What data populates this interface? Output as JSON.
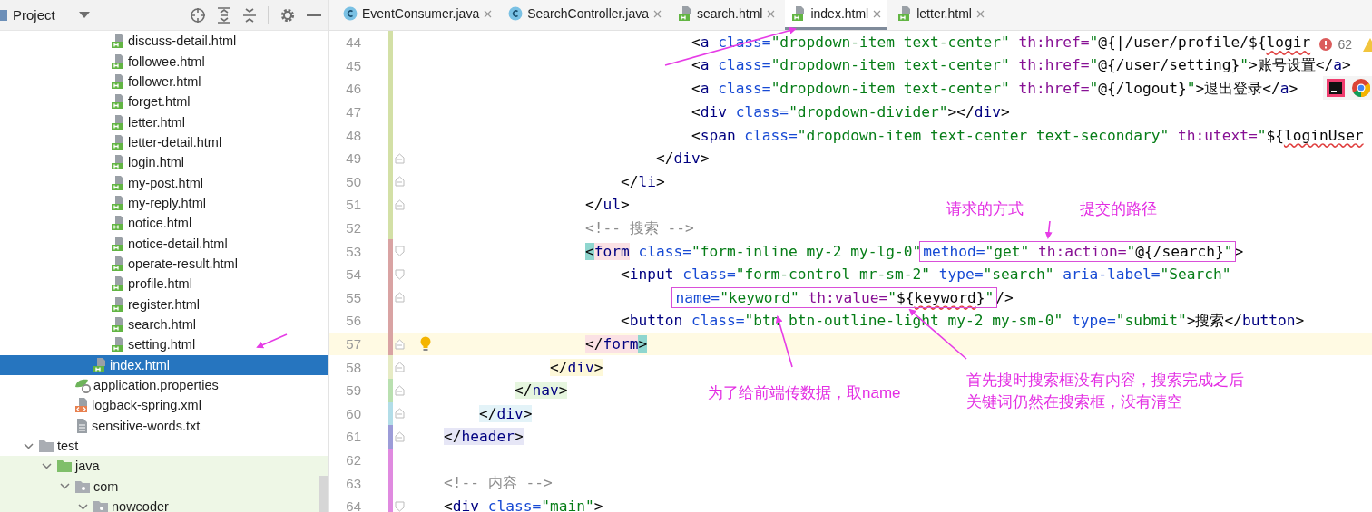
{
  "project_panel": {
    "title": "Project"
  },
  "tree": [
    {
      "children": [
        {
          "children": [
            {
              "children": [
                {
                  "children": [
                    {
                      "label": "discuss-detail.html",
                      "kind": "html",
                      "selected": false
                    },
                    {
                      "label": "followee.html",
                      "kind": "html",
                      "selected": false
                    },
                    {
                      "label": "follower.html",
                      "kind": "html",
                      "selected": false
                    },
                    {
                      "label": "forget.html",
                      "kind": "html",
                      "selected": false
                    },
                    {
                      "label": "letter.html",
                      "kind": "html",
                      "selected": false
                    },
                    {
                      "label": "letter-detail.html",
                      "kind": "html",
                      "selected": false
                    },
                    {
                      "label": "login.html",
                      "kind": "html",
                      "selected": false
                    },
                    {
                      "label": "my-post.html",
                      "kind": "html",
                      "selected": false
                    },
                    {
                      "label": "my-reply.html",
                      "kind": "html",
                      "selected": false
                    },
                    {
                      "label": "notice.html",
                      "kind": "html",
                      "selected": false
                    },
                    {
                      "label": "notice-detail.html",
                      "kind": "html",
                      "selected": false
                    },
                    {
                      "label": "operate-result.html",
                      "kind": "html",
                      "selected": false
                    },
                    {
                      "label": "profile.html",
                      "kind": "html",
                      "selected": false
                    },
                    {
                      "label": "register.html",
                      "kind": "html",
                      "selected": false
                    },
                    {
                      "label": "search.html",
                      "kind": "html",
                      "selected": false
                    },
                    {
                      "label": "setting.html",
                      "kind": "html",
                      "selected": false
                    }
                  ]
                },
                {
                  "label": "index.html",
                  "kind": "html",
                  "selected": true
                }
              ]
            },
            {
              "label": "application.properties",
              "kind": "properties",
              "selected": false
            },
            {
              "label": "logback-spring.xml",
              "kind": "xml",
              "selected": false
            },
            {
              "label": "sensitive-words.txt",
              "kind": "text",
              "selected": false
            }
          ]
        }
      ]
    },
    {
      "label": "test",
      "kind": "folder",
      "expanded": true,
      "selected": false,
      "children": [
        {
          "label": "java",
          "kind": "test-source-folder",
          "expanded": true,
          "selected": false,
          "children": [
            {
              "label": "com",
              "kind": "test-package",
              "expanded": true,
              "selected": false,
              "children": [
                {
                  "label": "nowcoder",
                  "kind": "test-package",
                  "expanded": true,
                  "selected": false
                }
              ]
            }
          ]
        }
      ]
    }
  ],
  "tabs": [
    {
      "label": "EventConsumer.java",
      "kind": "java",
      "selected": false
    },
    {
      "label": "SearchController.java",
      "kind": "java",
      "selected": false
    },
    {
      "label": "search.html",
      "kind": "html",
      "selected": false
    },
    {
      "label": "index.html",
      "kind": "html",
      "selected": true
    },
    {
      "label": "letter.html",
      "kind": "html",
      "selected": false
    }
  ],
  "problems": {
    "errors": "62"
  },
  "lines": [
    {
      "no": "44",
      "color": "#d3e0a6",
      "fold_start": false,
      "fold_end": false,
      "current": false,
      "bulb": false,
      "parts": [
        {
          "boxed": false,
          "tokens": [
            {
              "kind": "p",
              "text": "                            <"
            },
            {
              "kind": "tag",
              "text": "a"
            },
            {
              "kind": "attr",
              "text": " class="
            },
            {
              "kind": "str",
              "text": "\"dropdown-item text-center\""
            },
            {
              "kind": "th",
              "text": " th:href="
            },
            {
              "kind": "str",
              "text": "\""
            },
            {
              "kind": "expr",
              "text": "@{|/user/profile/${"
            },
            {
              "kind": "err",
              "text": "logir"
            }
          ]
        }
      ]
    },
    {
      "no": "45",
      "color": "#d3e0a6",
      "fold_start": false,
      "fold_end": false,
      "current": false,
      "bulb": false,
      "parts": [
        {
          "boxed": false,
          "tokens": [
            {
              "kind": "p",
              "text": "                            <"
            },
            {
              "kind": "tag",
              "text": "a"
            },
            {
              "kind": "attr",
              "text": " class="
            },
            {
              "kind": "str",
              "text": "\"dropdown-item text-center\""
            },
            {
              "kind": "th",
              "text": " th:href="
            },
            {
              "kind": "str",
              "text": "\""
            },
            {
              "kind": "expr",
              "text": "@{/user/setting}"
            },
            {
              "kind": "str",
              "text": "\""
            },
            {
              "kind": "p",
              "text": ">"
            },
            {
              "kind": "text",
              "text": "账号设置"
            },
            {
              "kind": "p",
              "text": "</"
            },
            {
              "kind": "tag",
              "text": "a"
            },
            {
              "kind": "p",
              "text": ">"
            }
          ]
        }
      ]
    },
    {
      "no": "46",
      "color": "#d3e0a6",
      "fold_start": false,
      "fold_end": false,
      "current": false,
      "bulb": false,
      "parts": [
        {
          "boxed": false,
          "tokens": [
            {
              "kind": "p",
              "text": "                            <"
            },
            {
              "kind": "tag",
              "text": "a"
            },
            {
              "kind": "attr",
              "text": " class="
            },
            {
              "kind": "str",
              "text": "\"dropdown-item text-center\""
            },
            {
              "kind": "th",
              "text": " th:href="
            },
            {
              "kind": "str",
              "text": "\""
            },
            {
              "kind": "expr",
              "text": "@{/logout}"
            },
            {
              "kind": "str",
              "text": "\""
            },
            {
              "kind": "p",
              "text": ">"
            },
            {
              "kind": "text",
              "text": "退出登录"
            },
            {
              "kind": "p",
              "text": "</"
            },
            {
              "kind": "tag",
              "text": "a"
            },
            {
              "kind": "p",
              "text": ">"
            }
          ]
        }
      ]
    },
    {
      "no": "47",
      "color": "#d3e0a6",
      "fold_start": false,
      "fold_end": false,
      "current": false,
      "bulb": false,
      "parts": [
        {
          "boxed": false,
          "tokens": [
            {
              "kind": "p",
              "text": "                            <"
            },
            {
              "kind": "tag",
              "text": "div"
            },
            {
              "kind": "attr",
              "text": " class="
            },
            {
              "kind": "str",
              "text": "\"dropdown-divider\""
            },
            {
              "kind": "p",
              "text": "></"
            },
            {
              "kind": "tag",
              "text": "div"
            },
            {
              "kind": "p",
              "text": ">"
            }
          ]
        }
      ]
    },
    {
      "no": "48",
      "color": "#d3e0a6",
      "fold_start": false,
      "fold_end": false,
      "current": false,
      "bulb": false,
      "parts": [
        {
          "boxed": false,
          "tokens": [
            {
              "kind": "p",
              "text": "                            <"
            },
            {
              "kind": "tag",
              "text": "span"
            },
            {
              "kind": "attr",
              "text": " class="
            },
            {
              "kind": "str",
              "text": "\"dropdown-item text-center text-secondary\""
            },
            {
              "kind": "th",
              "text": " th:utext="
            },
            {
              "kind": "str",
              "text": "\""
            },
            {
              "kind": "expr",
              "text": "${"
            },
            {
              "kind": "err",
              "text": "loginUser"
            }
          ]
        }
      ]
    },
    {
      "no": "49",
      "color": "#d3e0a6",
      "fold_start": false,
      "fold_end": true,
      "current": false,
      "bulb": false,
      "parts": [
        {
          "boxed": false,
          "tokens": [
            {
              "kind": "p",
              "text": "                        </"
            },
            {
              "kind": "tag",
              "text": "div"
            },
            {
              "kind": "p",
              "text": ">"
            }
          ]
        }
      ]
    },
    {
      "no": "50",
      "color": "#d3e0a6",
      "fold_start": false,
      "fold_end": true,
      "current": false,
      "bulb": false,
      "parts": [
        {
          "boxed": false,
          "tokens": [
            {
              "kind": "p",
              "text": "                    </"
            },
            {
              "kind": "tag",
              "text": "li"
            },
            {
              "kind": "p",
              "text": ">"
            }
          ]
        }
      ]
    },
    {
      "no": "51",
      "color": "#d3e0a6",
      "fold_start": false,
      "fold_end": true,
      "current": false,
      "bulb": false,
      "parts": [
        {
          "boxed": false,
          "tokens": [
            {
              "kind": "p",
              "text": "                </"
            },
            {
              "kind": "tag",
              "text": "ul"
            },
            {
              "kind": "p",
              "text": ">"
            }
          ]
        }
      ]
    },
    {
      "no": "52",
      "color": "#d3e0a6",
      "fold_start": false,
      "fold_end": false,
      "current": false,
      "bulb": false,
      "parts": [
        {
          "boxed": false,
          "tokens": [
            {
              "kind": "comment",
              "text": "                <!-- 搜索 -->"
            }
          ]
        }
      ]
    },
    {
      "no": "53",
      "color": "#d9a3a3",
      "fold_start": true,
      "fold_end": false,
      "current": false,
      "bulb": false,
      "parts": [
        {
          "boxed": false,
          "tokens": [
            {
              "kind": "p",
              "text": "                <",
              "color": "#8fd6cf"
            },
            {
              "kind": "tag",
              "text": "form",
              "color": "#fbe1e4"
            },
            {
              "kind": "attr",
              "text": " class="
            },
            {
              "kind": "str",
              "text": "\"form-inline my-2 my-lg-0\""
            }
          ]
        },
        {
          "boxed": true,
          "tokens": [
            {
              "kind": "attr",
              "text": "method="
            },
            {
              "kind": "str",
              "text": "\"get\""
            },
            {
              "kind": "th",
              "text": " th:action="
            },
            {
              "kind": "str",
              "text": "\""
            },
            {
              "kind": "expr",
              "text": "@{/search}"
            },
            {
              "kind": "str",
              "text": "\""
            }
          ]
        },
        {
          "boxed": false,
          "tokens": [
            {
              "kind": "p",
              "text": ">"
            }
          ]
        }
      ]
    },
    {
      "no": "54",
      "color": "#d9a3a3",
      "fold_start": true,
      "fold_end": false,
      "current": false,
      "bulb": false,
      "parts": [
        {
          "boxed": false,
          "tokens": [
            {
              "kind": "p",
              "text": "                    <"
            },
            {
              "kind": "tag",
              "text": "input"
            },
            {
              "kind": "attr",
              "text": " class="
            },
            {
              "kind": "str",
              "text": "\"form-control mr-sm-2\""
            },
            {
              "kind": "attr",
              "text": " type="
            },
            {
              "kind": "str",
              "text": "\"search\""
            },
            {
              "kind": "attr",
              "text": " aria-label="
            },
            {
              "kind": "str",
              "text": "\"Search\""
            }
          ]
        }
      ]
    },
    {
      "no": "55",
      "color": "#d9a3a3",
      "fold_start": false,
      "fold_end": true,
      "current": false,
      "bulb": false,
      "parts": [
        {
          "boxed": true,
          "tokens": [
            {
              "kind": "attr",
              "text": "                          name="
            },
            {
              "kind": "str",
              "text": "\"keyword\""
            },
            {
              "kind": "th",
              "text": " th:value="
            },
            {
              "kind": "str",
              "text": "\""
            },
            {
              "kind": "expr",
              "text": "${"
            },
            {
              "kind": "err",
              "text": "keyword"
            },
            {
              "kind": "expr",
              "text": "}"
            },
            {
              "kind": "str",
              "text": "\""
            }
          ]
        },
        {
          "boxed": false,
          "tokens": [
            {
              "kind": "p",
              "text": "/>"
            }
          ]
        }
      ]
    },
    {
      "no": "56",
      "color": "#d9a3a3",
      "fold_start": false,
      "fold_end": false,
      "current": false,
      "bulb": false,
      "parts": [
        {
          "boxed": false,
          "tokens": [
            {
              "kind": "p",
              "text": "                    <"
            },
            {
              "kind": "tag",
              "text": "button"
            },
            {
              "kind": "attr",
              "text": " class="
            },
            {
              "kind": "str",
              "text": "\"btn btn-outline-light my-2 my-sm-0\""
            },
            {
              "kind": "attr",
              "text": " type="
            },
            {
              "kind": "str",
              "text": "\"submit\""
            },
            {
              "kind": "p",
              "text": ">"
            },
            {
              "kind": "text",
              "text": "搜索"
            },
            {
              "kind": "p",
              "text": "</"
            },
            {
              "kind": "tag",
              "text": "button"
            },
            {
              "kind": "p",
              "text": ">"
            }
          ]
        }
      ]
    },
    {
      "no": "57",
      "color": "#d9a3a3",
      "fold_start": false,
      "fold_end": true,
      "current": true,
      "bulb": true,
      "parts": [
        {
          "boxed": false,
          "tokens": [
            {
              "kind": "p",
              "text": "                </",
              "color": "#fbe1e4"
            },
            {
              "kind": "tag",
              "text": "form",
              "color": "#fbe1e4"
            },
            {
              "kind": "p",
              "text": ">",
              "color": "#8fd6cf"
            }
          ]
        }
      ]
    },
    {
      "no": "58",
      "color": "#e6ebc4",
      "fold_start": false,
      "fold_end": true,
      "current": false,
      "bulb": false,
      "parts": [
        {
          "boxed": false,
          "tokens": [
            {
              "kind": "p",
              "text": "            </",
              "color": "#fdf8d8"
            },
            {
              "kind": "tag",
              "text": "div",
              "color": "#fdf8d8"
            },
            {
              "kind": "p",
              "text": ">",
              "color": "#fdf8d8"
            }
          ]
        }
      ]
    },
    {
      "no": "59",
      "color": "#b9e0b0",
      "fold_start": false,
      "fold_end": true,
      "current": false,
      "bulb": false,
      "parts": [
        {
          "boxed": false,
          "tokens": [
            {
              "kind": "p",
              "text": "        </",
              "color": "#e6f6df"
            },
            {
              "kind": "tag",
              "text": "nav",
              "color": "#e6f6df"
            },
            {
              "kind": "p",
              "text": ">",
              "color": "#e6f6df"
            }
          ]
        }
      ]
    },
    {
      "no": "60",
      "color": "#b2dde8",
      "fold_start": false,
      "fold_end": true,
      "current": false,
      "bulb": false,
      "parts": [
        {
          "boxed": false,
          "tokens": [
            {
              "kind": "p",
              "text": "    </",
              "color": "#e3f3f8"
            },
            {
              "kind": "tag",
              "text": "div",
              "color": "#e3f3f8"
            },
            {
              "kind": "p",
              "text": ">",
              "color": "#e3f3f8"
            }
          ]
        }
      ]
    },
    {
      "no": "61",
      "color": "#9c9cd8",
      "fold_start": false,
      "fold_end": true,
      "current": false,
      "bulb": false,
      "parts": [
        {
          "boxed": false,
          "tokens": [
            {
              "kind": "p",
              "text": "</",
              "color": "#e6e6f6"
            },
            {
              "kind": "tag",
              "text": "header",
              "color": "#e6e6f6"
            },
            {
              "kind": "p",
              "text": ">",
              "color": "#e6e6f6"
            }
          ]
        }
      ]
    },
    {
      "no": "62",
      "color": "#e08ae0",
      "fold_start": false,
      "fold_end": false,
      "current": false,
      "bulb": false
    },
    {
      "no": "63",
      "color": "#e08ae0",
      "fold_start": false,
      "fold_end": false,
      "current": false,
      "bulb": false,
      "parts": [
        {
          "boxed": false,
          "tokens": [
            {
              "kind": "comment",
              "text": "<!-- 内容 -->"
            }
          ]
        }
      ]
    },
    {
      "no": "64",
      "color": "#e08ae0",
      "fold_start": true,
      "fold_end": false,
      "current": false,
      "bulb": false,
      "parts": [
        {
          "boxed": false,
          "tokens": [
            {
              "kind": "p",
              "text": "<"
            },
            {
              "kind": "tag",
              "text": "div"
            },
            {
              "kind": "attr",
              "text": " class="
            },
            {
              "kind": "str",
              "text": "\"main\""
            },
            {
              "kind": "p",
              "text": ">"
            }
          ]
        }
      ]
    }
  ],
  "annotations": [
    {
      "text": "请求的方式"
    },
    {
      "text": "提交的路径"
    },
    {
      "text": "为了给前端传数据，取name"
    },
    {
      "text": "首先搜时搜索框没有内容，搜索完成之后"
    },
    {
      "text": "关键词仍然在搜索框，没有清空"
    }
  ]
}
